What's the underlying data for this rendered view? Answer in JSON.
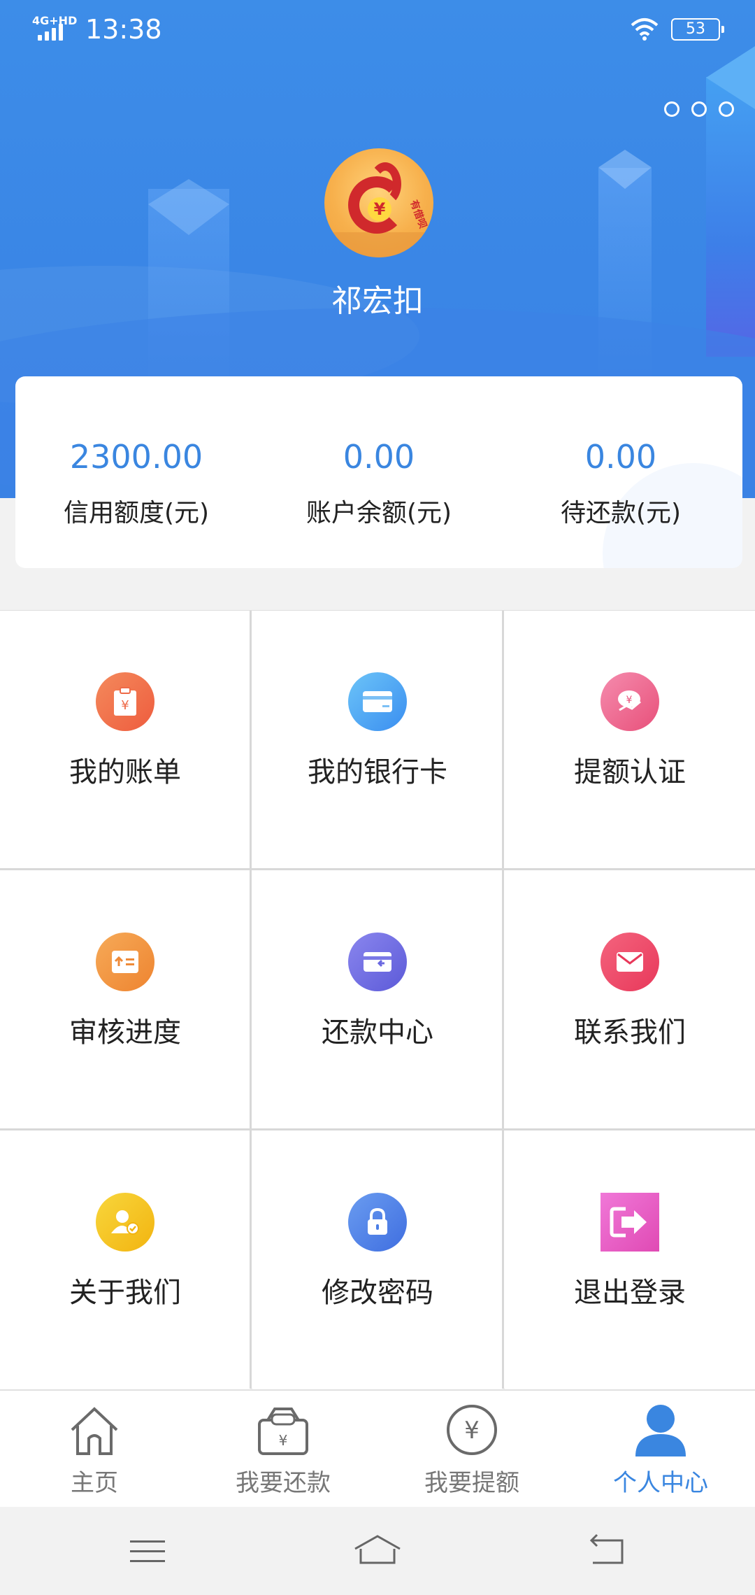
{
  "status_bar": {
    "network": "4G+HD",
    "time": "13:38",
    "battery": "53"
  },
  "profile": {
    "username": "祁宏扣",
    "avatar_stamp": "有借呗"
  },
  "stats": [
    {
      "value": "2300.00",
      "label": "信用额度(元)"
    },
    {
      "value": "0.00",
      "label": "账户余额(元)"
    },
    {
      "value": "0.00",
      "label": "待还款(元)"
    }
  ],
  "menu": [
    {
      "label": "我的账单",
      "icon": "bill-icon",
      "color": "#f06e4c"
    },
    {
      "label": "我的银行卡",
      "icon": "bank-card-icon",
      "color": "#4aa6f2"
    },
    {
      "label": "提额认证",
      "icon": "limit-increase-icon",
      "color": "#ee6a8e"
    },
    {
      "label": "审核进度",
      "icon": "review-progress-icon",
      "color": "#f0963c"
    },
    {
      "label": "还款中心",
      "icon": "repayment-center-icon",
      "color": "#6a6ee0"
    },
    {
      "label": "联系我们",
      "icon": "mail-icon",
      "color": "#ee4a6a"
    },
    {
      "label": "关于我们",
      "icon": "about-us-icon",
      "color": "#f5c318"
    },
    {
      "label": "修改密码",
      "icon": "lock-icon",
      "color": "#4a7ee6"
    },
    {
      "label": "退出登录",
      "icon": "logout-icon",
      "color": "#e860c8"
    }
  ],
  "bottom_nav": [
    {
      "label": "主页",
      "icon": "home-icon",
      "active": false
    },
    {
      "label": "我要还款",
      "icon": "repay-bag-icon",
      "active": false
    },
    {
      "label": "我要提额",
      "icon": "yen-circle-icon",
      "active": false
    },
    {
      "label": "个人中心",
      "icon": "user-icon",
      "active": true
    }
  ],
  "colors": {
    "primary": "#3a86e0",
    "header_bg": "#3d8de8"
  }
}
